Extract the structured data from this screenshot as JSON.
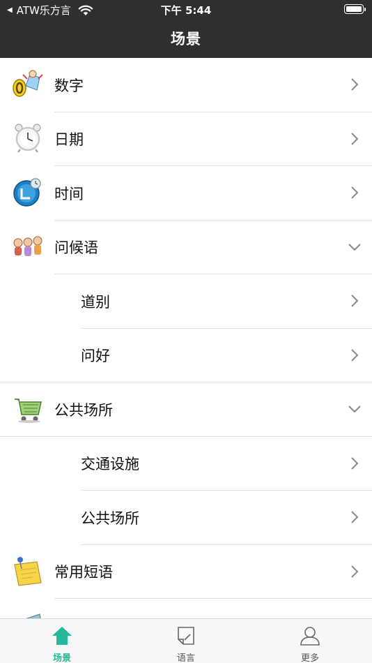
{
  "status_bar": {
    "carrier": "ATW乐方言",
    "time": "下午 5:44"
  },
  "header": {
    "title": "场景"
  },
  "list": {
    "items": [
      {
        "label": "数字",
        "icon": "numbers-icon",
        "indicator": "chevron-right"
      },
      {
        "label": "日期",
        "icon": "alarm-clock-icon",
        "indicator": "chevron-right"
      },
      {
        "label": "时间",
        "icon": "time-icon",
        "indicator": "chevron-right"
      },
      {
        "label": "问候语",
        "icon": "greeting-people-icon",
        "indicator": "chevron-down"
      },
      {
        "label": "道别",
        "indicator": "chevron-right"
      },
      {
        "label": "问好",
        "indicator": "chevron-right"
      },
      {
        "label": "公共场所",
        "icon": "shopping-cart-icon",
        "indicator": "chevron-down"
      },
      {
        "label": "交通设施",
        "indicator": "chevron-right"
      },
      {
        "label": "公共场所",
        "indicator": "chevron-right"
      },
      {
        "label": "常用短语",
        "icon": "sticky-note-icon",
        "indicator": "chevron-right"
      }
    ]
  },
  "tabbar": {
    "tabs": [
      {
        "label": "场景",
        "icon": "home-icon",
        "active": true
      },
      {
        "label": "语言",
        "icon": "note-icon",
        "active": false
      },
      {
        "label": "更多",
        "icon": "person-icon",
        "active": false
      }
    ]
  },
  "colors": {
    "header_bg": "#2f2f2f",
    "accent": "#25b89b"
  }
}
